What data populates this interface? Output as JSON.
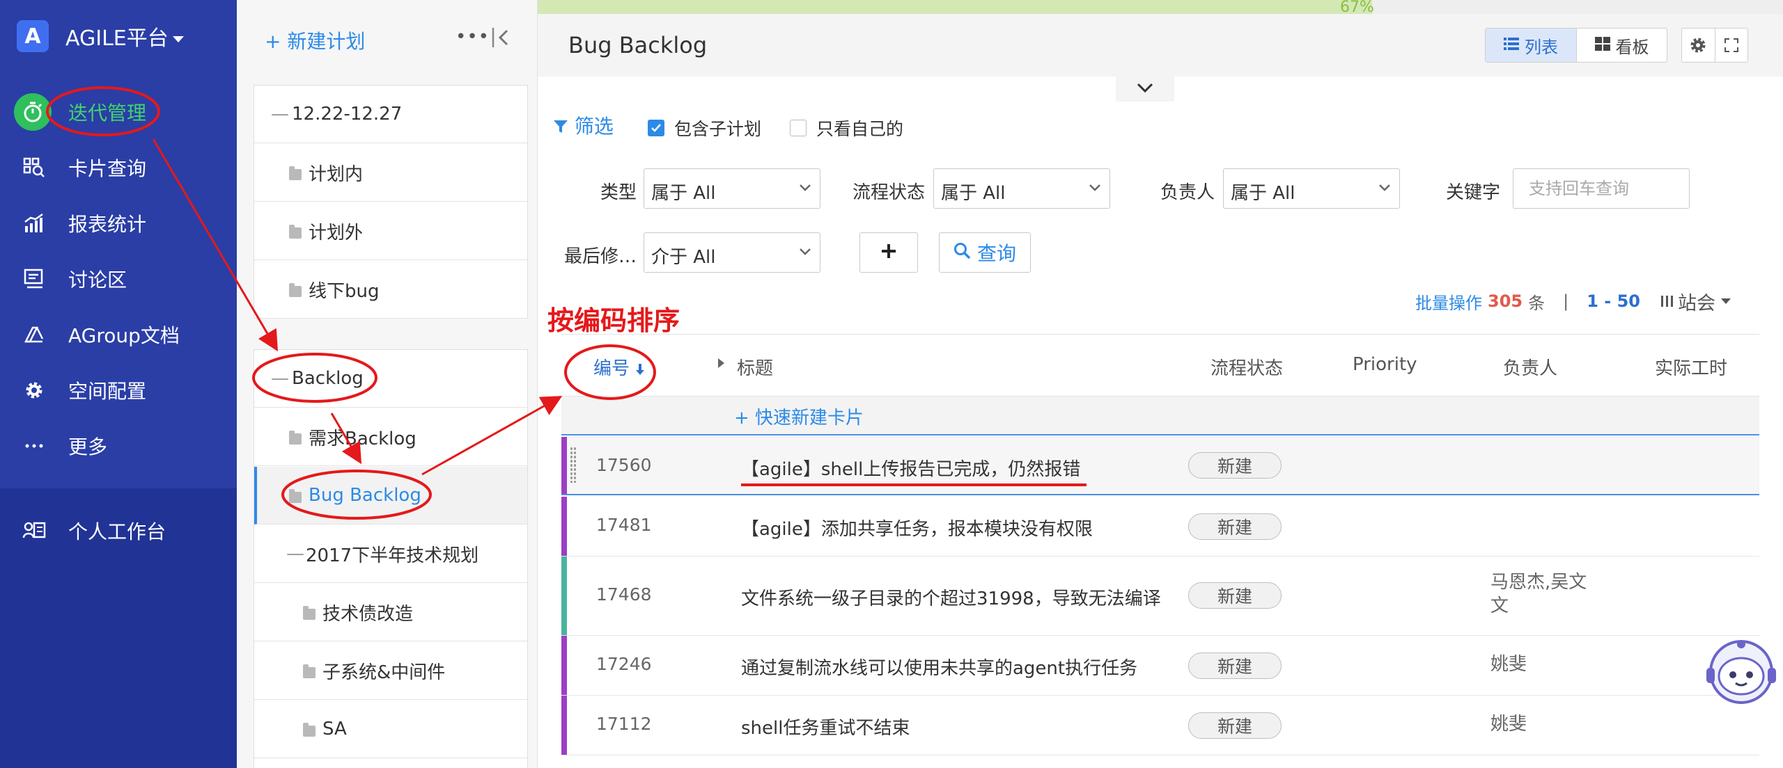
{
  "nav": {
    "brand_letter": "A",
    "brand_title": "AGILE平台",
    "items": [
      {
        "label": "迭代管理",
        "icon": "stopwatch-icon",
        "active": true
      },
      {
        "label": "卡片查询",
        "icon": "card-search-icon"
      },
      {
        "label": "报表统计",
        "icon": "chart-icon"
      },
      {
        "label": "讨论区",
        "icon": "discussion-icon"
      },
      {
        "label": "AGroup文档",
        "icon": "document-icon"
      },
      {
        "label": "空间配置",
        "icon": "gear-icon"
      },
      {
        "label": "更多",
        "icon": "more-icon"
      }
    ],
    "workspace": {
      "label": "个人工作台",
      "icon": "user-card-icon"
    },
    "colors": {
      "background": "#2a3ea6",
      "active": "#2fbf5d"
    }
  },
  "plans": {
    "new_label": "+ 新建计划",
    "group1": [
      {
        "label": "12.22-12.27",
        "kind": "minus"
      },
      {
        "label": "计划内",
        "kind": "folder"
      },
      {
        "label": "计划外",
        "kind": "folder"
      },
      {
        "label": "线下bug",
        "kind": "folder"
      }
    ],
    "group2": [
      {
        "label": "Backlog",
        "kind": "minus"
      },
      {
        "label": "需求Backlog",
        "kind": "folder"
      },
      {
        "label": "Bug Backlog",
        "kind": "folder",
        "selected": true
      },
      {
        "label": "2017下半年技术规划",
        "kind": "minus"
      },
      {
        "label": "技术债改造",
        "kind": "folder"
      },
      {
        "label": "子系统&中间件",
        "kind": "folder"
      },
      {
        "label": "SA",
        "kind": "folder"
      }
    ]
  },
  "main": {
    "progress_text": "67%",
    "progress_value": 0.67,
    "title": "Bug Backlog",
    "view_list": "列表",
    "view_board": "看板",
    "filter_toggle": "筛选",
    "include_sub": "包含子计划",
    "only_mine": "只看自己的",
    "filters": {
      "type_label": "类型",
      "type_value": "属于 All",
      "flow_label": "流程状态",
      "flow_value": "属于 All",
      "owner_label": "负责人",
      "owner_value": "属于 All",
      "keyword_label": "关键字",
      "keyword_placeholder": "支持回车查询",
      "modified_label": "最后修…",
      "modified_value": "介于 All",
      "add_button": "+",
      "query_button": "查询"
    },
    "batch": {
      "label": "批量操作",
      "count": "305",
      "unit": "条",
      "sep": "|",
      "range": "1 - 50",
      "site": "站会"
    },
    "columns": {
      "id": "编号",
      "title": "标题",
      "flow": "流程状态",
      "priority": "Priority",
      "owner": "负责人",
      "hours": "实际工时"
    },
    "quick_add": "+   快速新建卡片",
    "rows": [
      {
        "id": "17560",
        "title": "【agile】shell上传报告已完成，仍然报错",
        "status": "新建",
        "owner": "",
        "bar": "#9b3fc6"
      },
      {
        "id": "17481",
        "title": "【agile】添加共享任务，报本模块没有权限",
        "status": "新建",
        "owner": "",
        "bar": "#9b3fc6"
      },
      {
        "id": "17468",
        "title": "文件系统一级子目录的个超过31998，导致无法编译",
        "status": "新建",
        "owner": "马恩杰,吴文\n文",
        "bar": "#4ab49e"
      },
      {
        "id": "17246",
        "title": "通过复制流水线可以使用未共享的agent执行任务",
        "status": "新建",
        "owner": "姚斐",
        "bar": "#9b3fc6"
      },
      {
        "id": "17112",
        "title": "shell任务重试不结束",
        "status": "新建",
        "owner": "姚斐",
        "bar": "#9b3fc6"
      }
    ]
  },
  "annotation": {
    "text": "按编码排序",
    "color": "#e4191b"
  }
}
